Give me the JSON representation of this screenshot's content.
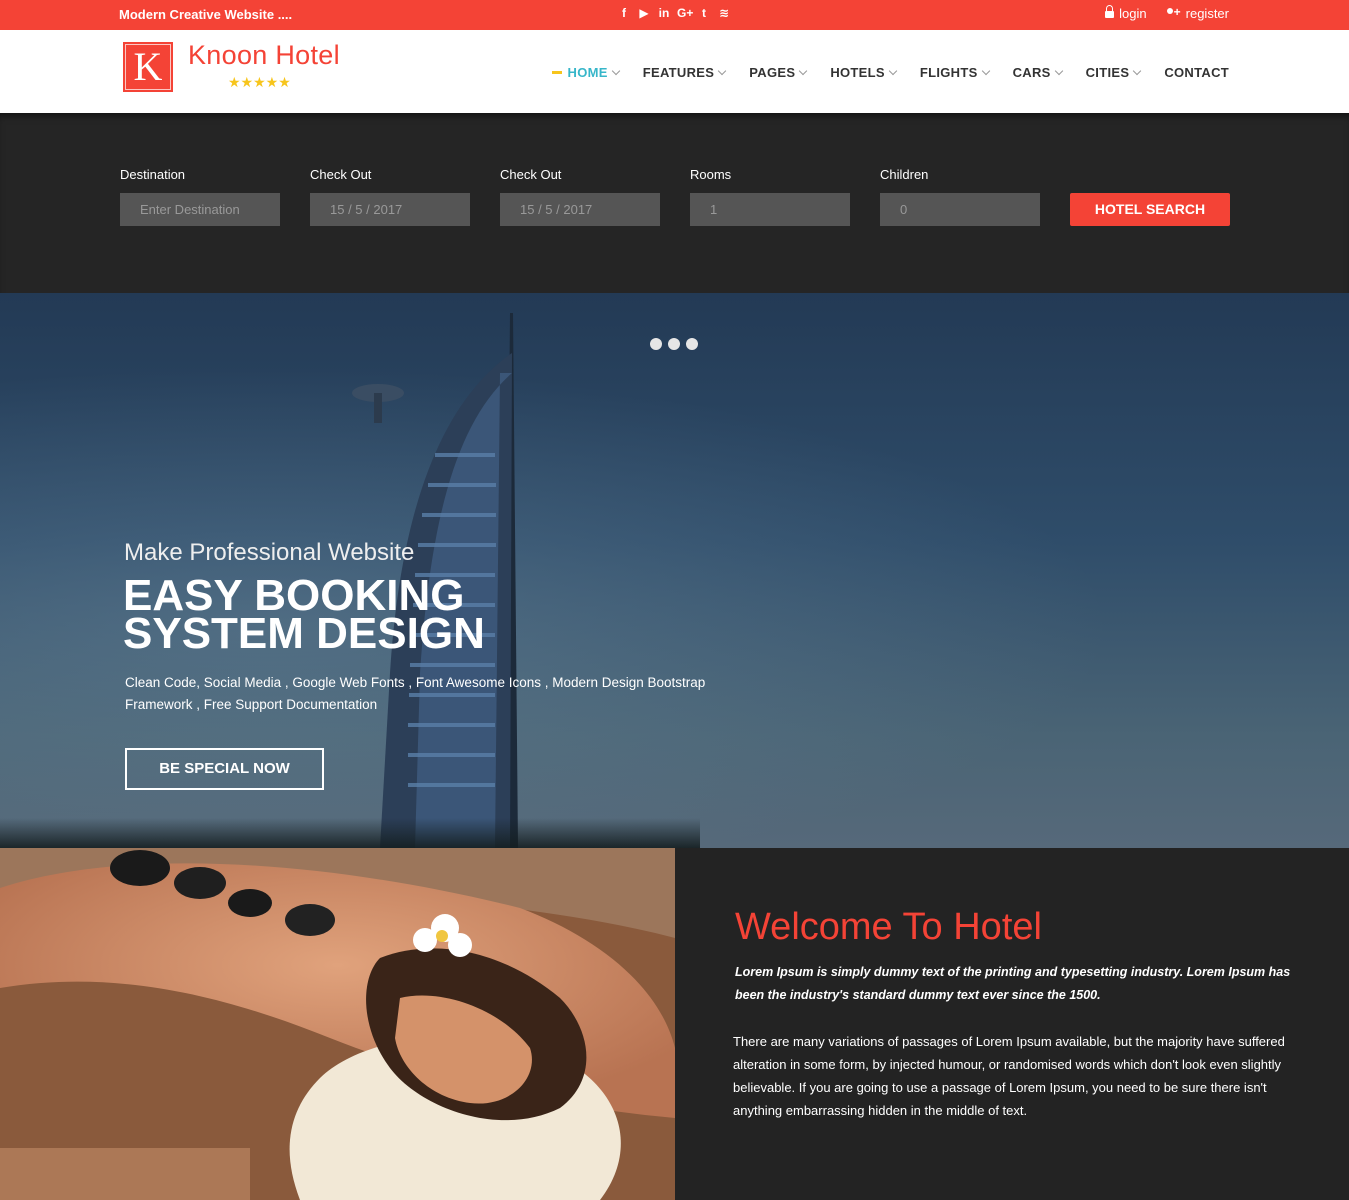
{
  "topbar": {
    "tagline": "Modern Creative Website ....",
    "social": [
      {
        "icon": "facebook-icon",
        "glyph": "f"
      },
      {
        "icon": "youtube-icon",
        "glyph": "▶"
      },
      {
        "icon": "linkedin-icon",
        "glyph": "in"
      },
      {
        "icon": "google-plus-icon",
        "glyph": "G+"
      },
      {
        "icon": "twitter-icon",
        "glyph": "t"
      },
      {
        "icon": "rss-icon",
        "glyph": "≋"
      }
    ],
    "login": "login",
    "register": "register"
  },
  "brand": {
    "letter": "K",
    "name": "Knoon Hotel",
    "stars": "★★★★★"
  },
  "nav": {
    "items": [
      {
        "label": "HOME",
        "dropdown": true
      },
      {
        "label": "FEATURES",
        "dropdown": true
      },
      {
        "label": "PAGES",
        "dropdown": true
      },
      {
        "label": "HOTELS",
        "dropdown": true
      },
      {
        "label": "FLIGHTS",
        "dropdown": true
      },
      {
        "label": "CARS",
        "dropdown": true
      },
      {
        "label": "CITIES",
        "dropdown": true
      },
      {
        "label": "CONTACT",
        "dropdown": false
      }
    ]
  },
  "search": {
    "fields": [
      {
        "label": "Destination",
        "placeholder": "Enter Destination"
      },
      {
        "label": "Check Out",
        "placeholder": "15 / 5 / 2017"
      },
      {
        "label": "Check Out",
        "placeholder": "15 / 5 / 2017"
      },
      {
        "label": "Rooms",
        "placeholder": "1"
      },
      {
        "label": "Children",
        "placeholder": "0"
      }
    ],
    "button": "HOTEL SEARCH"
  },
  "hero": {
    "kicker": "Make Professional Website",
    "headline_line1": "EASY BOOKING",
    "headline_line2": "SYSTEM DESIGN",
    "description": "Clean Code, Social Media , Google Web Fonts , Font Awesome Icons , Modern Design Bootstrap Framework , Free Support Documentation",
    "cta": "BE SPECIAL NOW",
    "slides": 3
  },
  "welcome": {
    "title": "Welcome To Hotel",
    "lead": "Lorem Ipsum is simply dummy text of the printing and typesetting industry. Lorem Ipsum has been the industry's standard dummy text ever since the 1500.",
    "body": "There are many variations of passages of Lorem Ipsum available, but the majority have suffered alteration in some form, by injected humour, or randomised words which don't look even slightly believable. If you are going to use a passage of Lorem Ipsum, you need to be sure there isn't anything embarrassing hidden in the middle of text."
  },
  "colors": {
    "accent": "#f44336",
    "active_nav": "#37b6c9",
    "star": "#f7c51c",
    "dark": "#232323"
  }
}
